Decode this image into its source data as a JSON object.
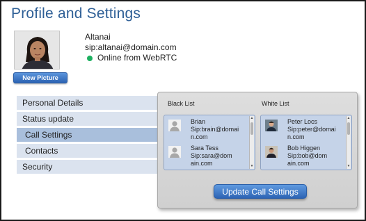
{
  "header": {
    "title": "Profile and Settings"
  },
  "profile": {
    "avatar_icon": "user-photo",
    "new_picture_label": "New Picture",
    "name": "Altanai",
    "sip": "sip:altanai@domain.com",
    "status": "Online from WebRTC",
    "status_color": "#1db060"
  },
  "nav": {
    "items": [
      {
        "label": "Personal Details"
      },
      {
        "label": "Status update"
      },
      {
        "label": "Call Settings",
        "active": true
      },
      {
        "label": "Contacts"
      },
      {
        "label": "Security"
      }
    ]
  },
  "call_settings": {
    "black_list": {
      "title": "Black List",
      "contacts": [
        {
          "name": "Brian",
          "sip_line1": "Sip:brain@domai",
          "sip_line2": "n.com",
          "icon": "generic-user-icon"
        },
        {
          "name": "Sara Tess",
          "sip_line1": "Sip:sara@dom",
          "sip_line2": "ain.com",
          "icon": "generic-user-icon"
        }
      ]
    },
    "white_list": {
      "title": "White List",
      "contacts": [
        {
          "name": "Peter Locs",
          "sip_line1": "Sip:peter@domai",
          "sip_line2": "n.com",
          "icon": "person-photo-icon"
        },
        {
          "name": "Bob Higgen",
          "sip_line1": "Sip:bob@dom",
          "sip_line2": "ain.com",
          "icon": "person-photo-icon"
        }
      ]
    },
    "update_label": "Update Call  Settings"
  },
  "colors": {
    "title": "#2e5f96",
    "button": "#2c63b3",
    "nav_bg": "#dbe3ef",
    "nav_active": "#a9bfdc",
    "list_bg": "#c5d3e8"
  }
}
